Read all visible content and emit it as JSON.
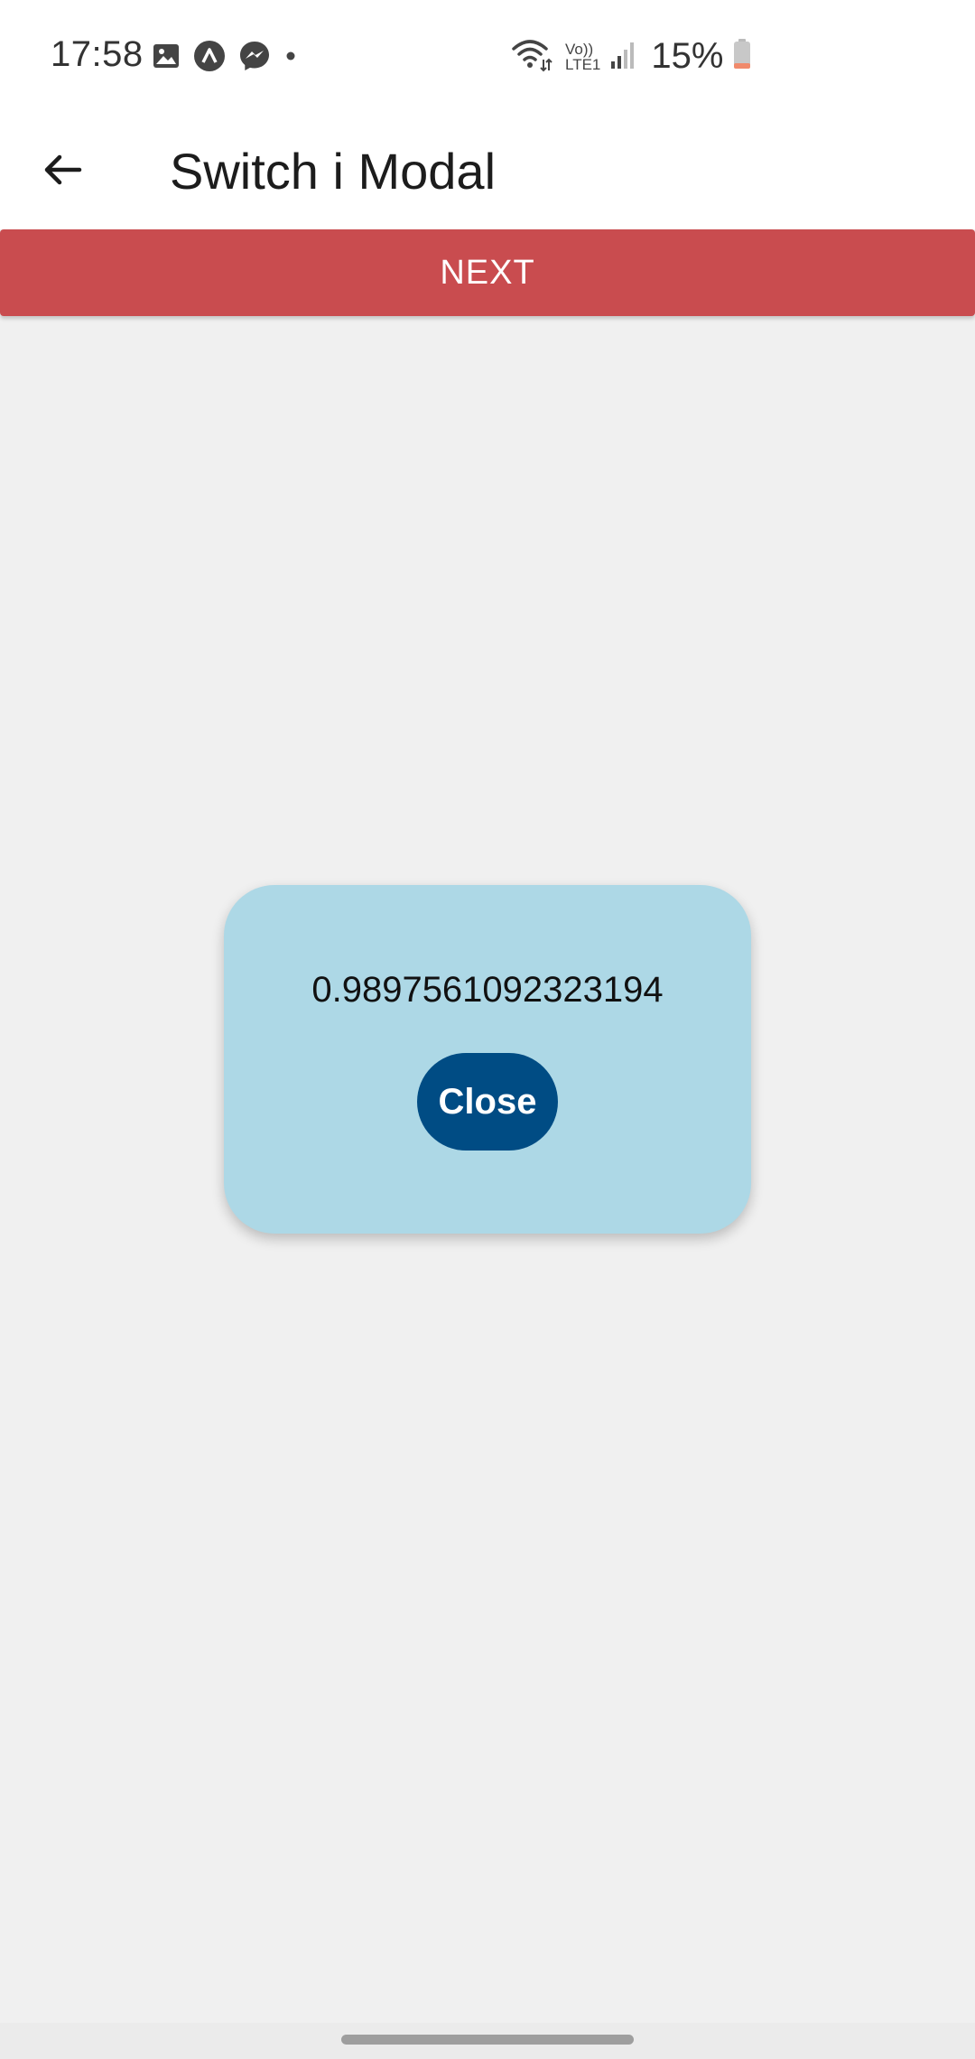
{
  "status_bar": {
    "time": "17:58",
    "notification_icons": [
      "gallery-icon",
      "expo-icon",
      "messenger-icon",
      "dot-icon"
    ],
    "network_label_top": "Vo))",
    "network_label_bottom": "LTE1",
    "battery_percent": "15%"
  },
  "app_bar": {
    "back_icon": "arrow-left-icon",
    "title": "Switch i Modal"
  },
  "next_button": {
    "label": "NEXT",
    "color": "#c94c4f"
  },
  "modal": {
    "value": "0.9897561092323194",
    "close_label": "Close",
    "background": "#add8e6",
    "button_color": "#004c84"
  }
}
